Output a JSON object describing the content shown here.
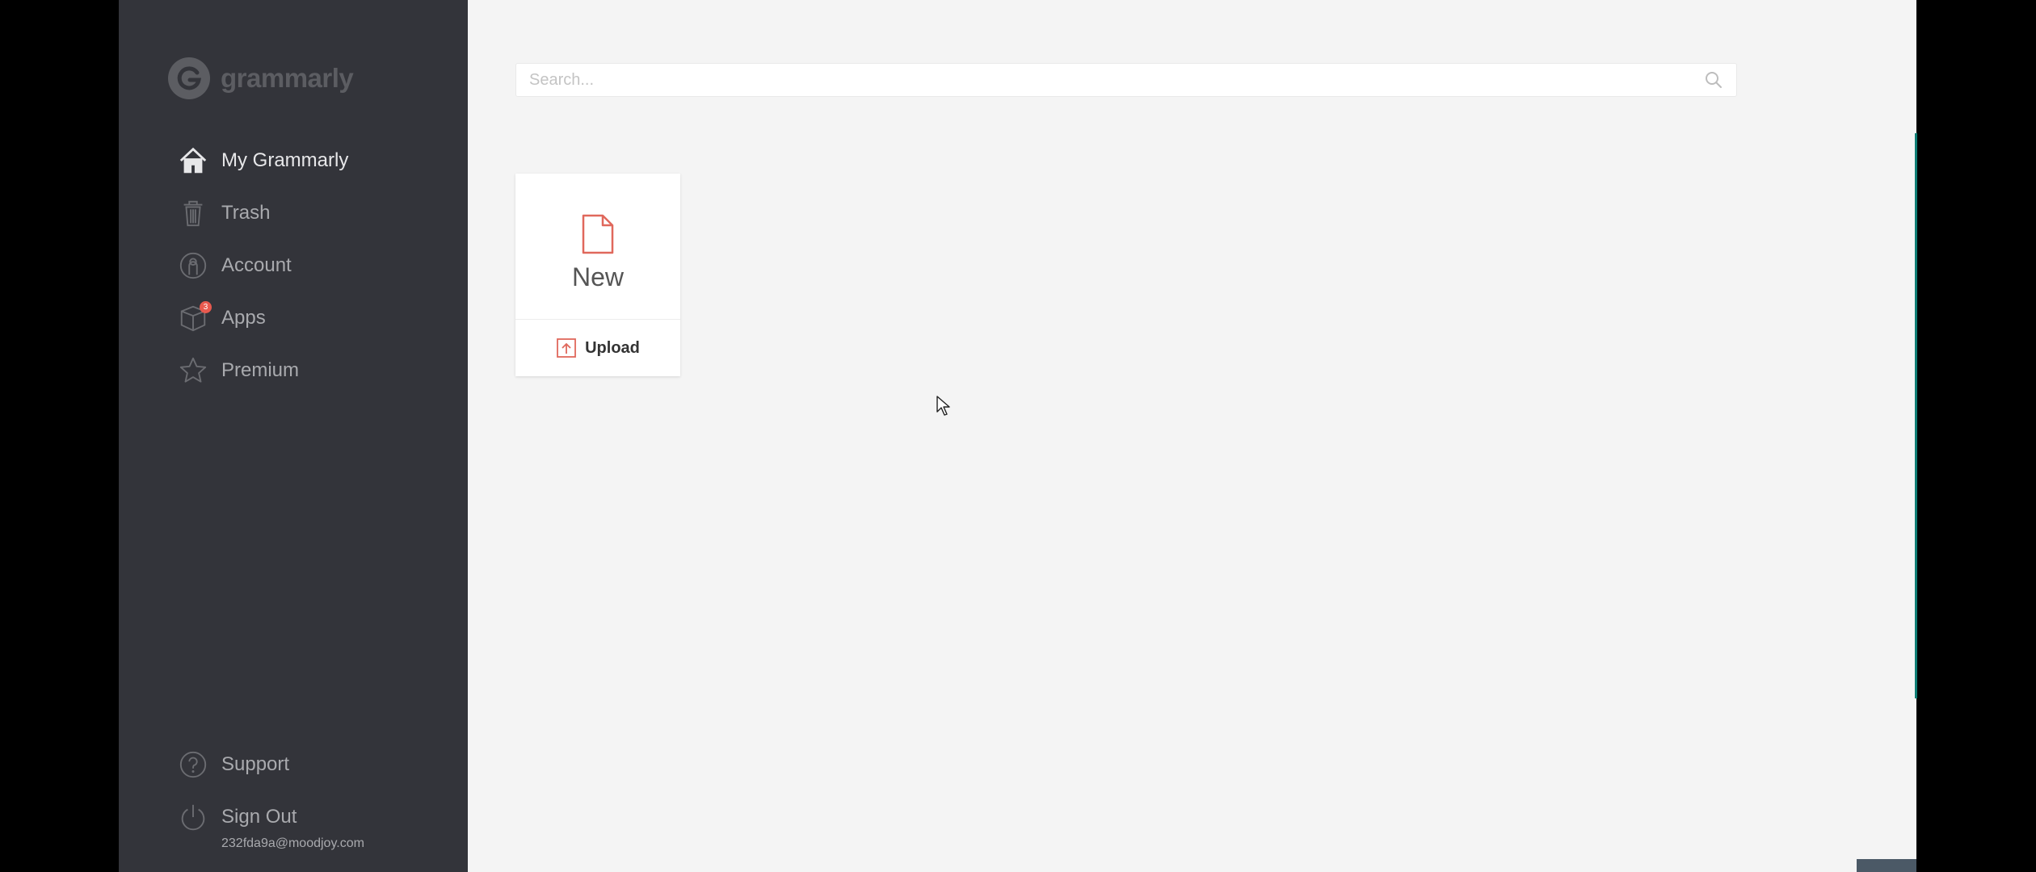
{
  "app": {
    "brand": "grammarly"
  },
  "sidebar": {
    "items": [
      {
        "label": "My Grammarly",
        "icon": "home-icon",
        "active": true
      },
      {
        "label": "Trash",
        "icon": "trash-icon",
        "active": false
      },
      {
        "label": "Account",
        "icon": "account-icon",
        "active": false
      },
      {
        "label": "Apps",
        "icon": "apps-box-icon",
        "active": false,
        "badge": "3"
      },
      {
        "label": "Premium",
        "icon": "star-icon",
        "active": false
      }
    ],
    "bottom_items": [
      {
        "label": "Support",
        "icon": "question-icon"
      },
      {
        "label": "Sign Out",
        "icon": "power-icon"
      }
    ],
    "email": "232fda9a@moodjoy.com"
  },
  "search": {
    "placeholder": "Search..."
  },
  "new_card": {
    "new_label": "New",
    "upload_label": "Upload"
  },
  "colors": {
    "sidebar_bg": "#33343a",
    "main_bg": "#f4f4f4",
    "accent": "#e0685c",
    "badge": "#e85a4f"
  }
}
